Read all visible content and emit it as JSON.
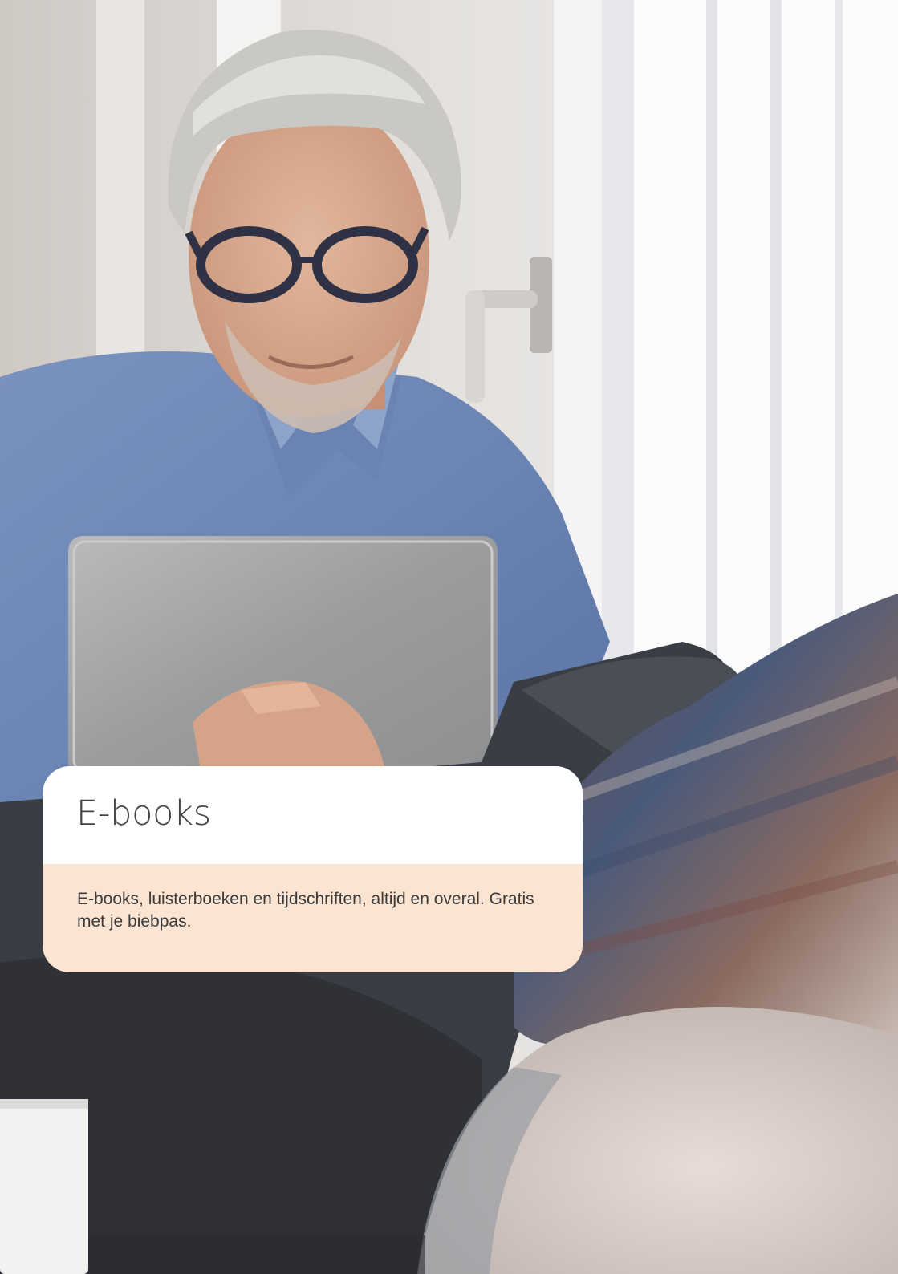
{
  "card": {
    "title": "E-books",
    "description": "E-books, luisterboeken en tijdschriften, altijd en overal. Gratis met je biebpas."
  },
  "colors": {
    "card_header": "#ffffff",
    "card_body": "#fce4d3",
    "title_text": "#444444",
    "body_text": "#3a3a3a"
  },
  "photo": {
    "subject": "man-with-glasses-reading-tablet-by-window",
    "icon": "photo-icon"
  }
}
